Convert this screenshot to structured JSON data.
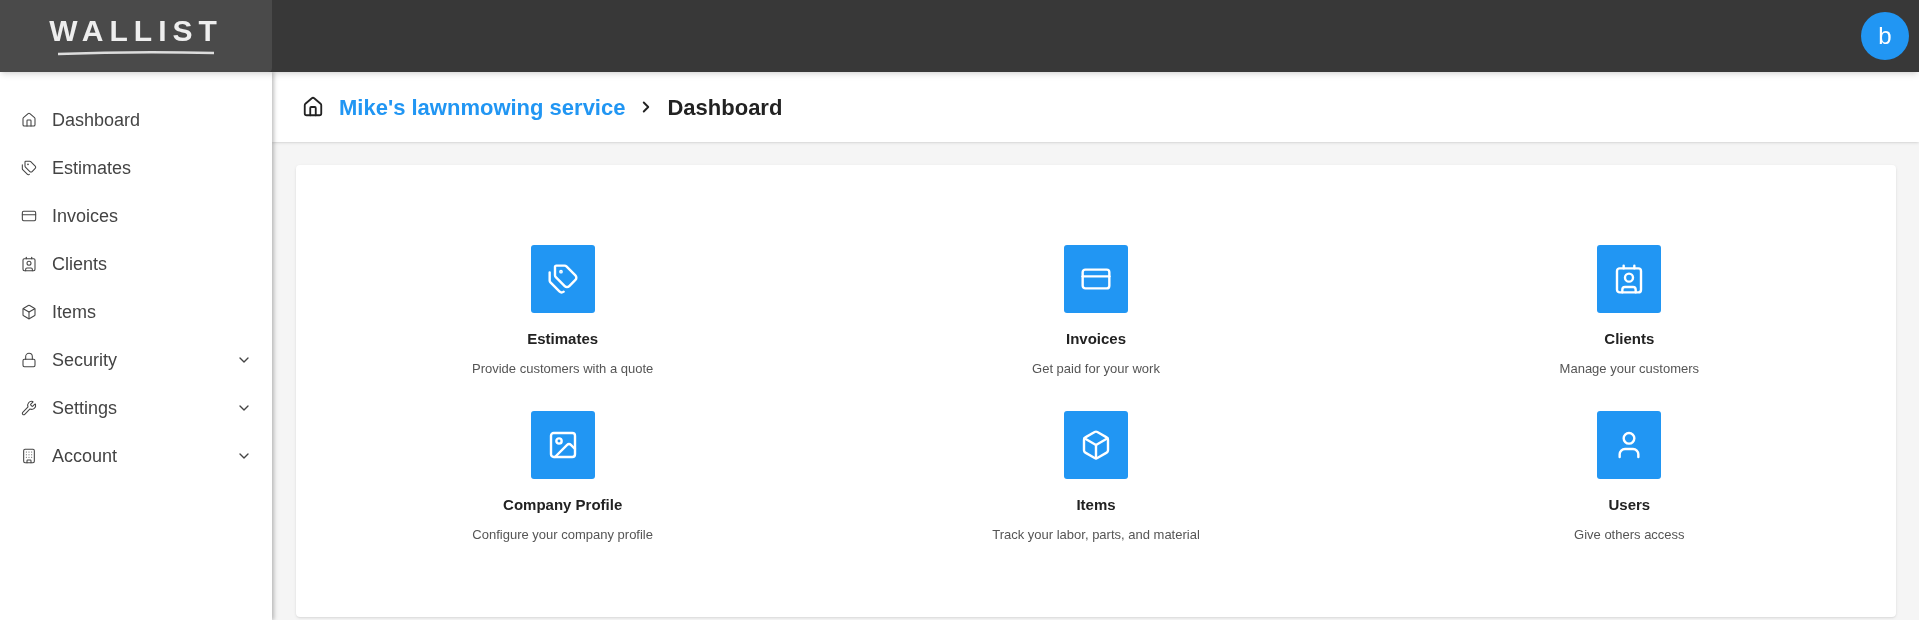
{
  "logo": {
    "text": "WALLIST"
  },
  "user_avatar": {
    "initial": "b"
  },
  "sidebar": {
    "items": [
      {
        "label": "Dashboard",
        "has_submenu": false
      },
      {
        "label": "Estimates",
        "has_submenu": false
      },
      {
        "label": "Invoices",
        "has_submenu": false
      },
      {
        "label": "Clients",
        "has_submenu": false
      },
      {
        "label": "Items",
        "has_submenu": false
      },
      {
        "label": "Security",
        "has_submenu": true
      },
      {
        "label": "Settings",
        "has_submenu": true
      },
      {
        "label": "Account",
        "has_submenu": true
      }
    ]
  },
  "breadcrumb": {
    "parent": "Mike's lawnmowing service",
    "current": "Dashboard"
  },
  "tiles": [
    {
      "title": "Estimates",
      "description": "Provide customers with a quote"
    },
    {
      "title": "Invoices",
      "description": "Get paid for your work"
    },
    {
      "title": "Clients",
      "description": "Manage your customers"
    },
    {
      "title": "Company Profile",
      "description": "Configure your company profile"
    },
    {
      "title": "Items",
      "description": "Track your labor, parts, and material"
    },
    {
      "title": "Users",
      "description": "Give others access"
    }
  ]
}
